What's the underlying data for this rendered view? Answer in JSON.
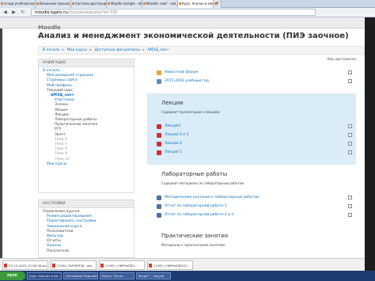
{
  "browser": {
    "tabs": [
      {
        "label": "отзыв учебной вкладкой...",
        "active": false
      },
      {
        "label": "Вложения письма. Сделан...",
        "active": false
      },
      {
        "label": "Система дистанционного обу...",
        "active": false
      },
      {
        "label": "Moodle Sample - образов...",
        "active": false
      },
      {
        "label": "Moodle: сайт - ads.pe.com...",
        "active": false
      },
      {
        "label": "Курс: Анализ и менеджмент...",
        "active": true
      }
    ],
    "new_tab": "+",
    "url_host": "moodle.kgatu.ru",
    "url_path": "/course/view.php?id=335"
  },
  "moodle": {
    "brand": "Moodle"
  },
  "course": {
    "title": "Анализ и менеджмент экономической деятельности (ПИЭ заочное)",
    "breadcrumb": [
      "В начало",
      "Мои курсы",
      "Доступные дисциплины",
      "АМЭД_заоч"
    ]
  },
  "navigation": {
    "header": "НАВИГАЦИЯ",
    "items": [
      {
        "label": "В начало",
        "style": "link",
        "indent": 0
      },
      {
        "label": "Моя домашняя страница",
        "style": "link",
        "indent": 1
      },
      {
        "label": "Страницы сайта",
        "style": "link",
        "indent": 1
      },
      {
        "label": "Мой профиль",
        "style": "link",
        "indent": 1
      },
      {
        "label": "Текущий курс",
        "style": "plain",
        "indent": 1
      },
      {
        "label": "АМЭД_заоч",
        "style": "bold",
        "indent": 2
      },
      {
        "label": "Участники",
        "style": "link",
        "indent": 3
      },
      {
        "label": "Значки",
        "style": "plain",
        "indent": 3
      },
      {
        "label": "Общее",
        "style": "plain",
        "indent": 3
      },
      {
        "label": "Лекции",
        "style": "plain",
        "indent": 3
      },
      {
        "label": "Лабораторные работы",
        "style": "plain",
        "indent": 3
      },
      {
        "label": "Практические занятия",
        "style": "plain",
        "indent": 3
      },
      {
        "label": "РГР",
        "style": "plain",
        "indent": 3
      },
      {
        "label": "Зачет",
        "style": "plain",
        "indent": 3
      },
      {
        "label": "Тема 6",
        "style": "grey",
        "indent": 3
      },
      {
        "label": "Тема 7",
        "style": "grey",
        "indent": 3
      },
      {
        "label": "Тема 8",
        "style": "grey",
        "indent": 3
      },
      {
        "label": "Тема 9",
        "style": "grey",
        "indent": 3
      },
      {
        "label": "Тема 10",
        "style": "grey",
        "indent": 3
      },
      {
        "label": "Мои курсы",
        "style": "link",
        "indent": 1
      }
    ]
  },
  "settings": {
    "header": "НАСТРОЙКИ",
    "items": [
      {
        "label": "Управление курсом",
        "style": "plain",
        "indent": 0
      },
      {
        "label": "Режим редактирования",
        "style": "link",
        "indent": 1
      },
      {
        "label": "Редактировать настройки",
        "style": "link",
        "indent": 1
      },
      {
        "label": "Завершение курса",
        "style": "link",
        "indent": 1
      },
      {
        "label": "Пользователи",
        "style": "plain",
        "indent": 1
      },
      {
        "label": "Фильтры",
        "style": "link",
        "indent": 1
      },
      {
        "label": "Отчеты",
        "style": "plain",
        "indent": 1
      },
      {
        "label": "Оценки",
        "style": "link",
        "indent": 1
      },
      {
        "label": "Показатели",
        "style": "plain",
        "indent": 1
      }
    ]
  },
  "main": {
    "progress_note": "Ваш достижения",
    "top_activities": [
      {
        "label": "Новостной форум",
        "icon": "forum-icon"
      },
      {
        "label": "2015-2016 учебный год",
        "icon": "folder-icon"
      }
    ],
    "sections": [
      {
        "title": "Лекции",
        "summary": "Содержит презентации к лекциям",
        "highlighted": true,
        "activities": [
          "Лекция1",
          "Лекция 2 и 3",
          "Лекция 4",
          "Лекция 5"
        ]
      },
      {
        "title": "Лабораторные работы",
        "summary": "Содержит материалы по лабораторным работам",
        "highlighted": false,
        "activities": [
          "Методические указания к лабораторным работам",
          "Отчет по лабораторной работе 1",
          "Отчет по лабораторной работе 2 и 3"
        ]
      },
      {
        "title": "Практические занятия",
        "summary": "Материалы к практическим занятиям",
        "highlighted": false,
        "activities": []
      }
    ]
  },
  "downloads": [
    "25-10-2015_13-08-36.zip",
    "17042_ЛчРЗКП06...doc",
    "11082_сЧИРНаПБО...",
    "11082_сЧИРНаПМ151..."
  ],
  "taskbar": {
    "start": "пуск",
    "items": [
      "Курс: Анализ и ме...",
      "Состояние Подключен...",
      "Вагон: Тесты...",
      "Skype™ - tanyad"
    ]
  }
}
